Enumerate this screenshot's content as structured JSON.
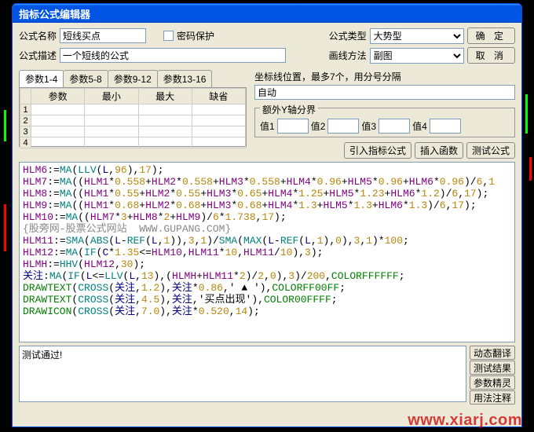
{
  "window": {
    "title": "指标公式编辑器"
  },
  "labels": {
    "formula_name": "公式名称",
    "password": "密码保护",
    "formula_type": "公式类型",
    "formula_desc": "公式描述",
    "draw_method": "画线方法",
    "coord_hint": "坐标线位置，最多7个，用分号分隔",
    "extra_y": "额外Y轴分界",
    "v1": "值1",
    "v2": "值2",
    "v3": "值3",
    "v4": "值4"
  },
  "values": {
    "formula_name": "短线买点",
    "formula_desc": "一个短线的公式",
    "formula_type_selected": "大势型",
    "draw_method_selected": "副图",
    "coord_value": "自动",
    "test_result": "测试通过!"
  },
  "buttons": {
    "ok": "确 定",
    "cancel": "取 消",
    "import": "引入指标公式",
    "insert_fn": "插入函数",
    "test": "测试公式",
    "dyn_trans": "动态翻译",
    "test_result": "测试结果",
    "param_wizard": "参数精灵",
    "usage": "用法注释"
  },
  "param_tabs": [
    "参数1-4",
    "参数5-8",
    "参数9-12",
    "参数13-16"
  ],
  "param_headers": [
    "参数",
    "最小",
    "最大",
    "缺省"
  ],
  "code_lines": [
    [
      [
        "c-id",
        "HLM6"
      ],
      [
        "",
        ":="
      ],
      [
        "c-fn",
        "MA"
      ],
      [
        "",
        "("
      ],
      [
        "c-fn",
        "LLV"
      ],
      [
        "",
        "("
      ],
      [
        "c-nav",
        "L"
      ],
      [
        "",
        ","
      ],
      [
        "c-num",
        "96"
      ],
      [
        "",
        "),"
      ],
      [
        "c-num",
        "17"
      ],
      [
        "",
        ");"
      ]
    ],
    [
      [
        "c-id",
        "HLM7"
      ],
      [
        "",
        ":="
      ],
      [
        "c-fn",
        "MA"
      ],
      [
        "",
        "(("
      ],
      [
        "c-id",
        "HLM1"
      ],
      [
        "",
        "*"
      ],
      [
        "c-num",
        "0.558"
      ],
      [
        "",
        "+"
      ],
      [
        "c-id",
        "HLM2"
      ],
      [
        "",
        "*"
      ],
      [
        "c-num",
        "0.558"
      ],
      [
        "",
        "+"
      ],
      [
        "c-id",
        "HLM3"
      ],
      [
        "",
        "*"
      ],
      [
        "c-num",
        "0.558"
      ],
      [
        "",
        "+"
      ],
      [
        "c-id",
        "HLM4"
      ],
      [
        "",
        "*"
      ],
      [
        "c-num",
        "0.96"
      ],
      [
        "",
        "+"
      ],
      [
        "c-id",
        "HLM5"
      ],
      [
        "",
        "*"
      ],
      [
        "c-num",
        "0.96"
      ],
      [
        "",
        "+"
      ],
      [
        "c-id",
        "HLM6"
      ],
      [
        "",
        "*"
      ],
      [
        "c-num",
        "0.96"
      ],
      [
        "",
        ")/"
      ],
      [
        "c-num",
        "6"
      ],
      [
        "",
        ","
      ],
      [
        "c-num",
        "1"
      ]
    ],
    [
      [
        "c-id",
        "HLM8"
      ],
      [
        "",
        ":="
      ],
      [
        "c-fn",
        "MA"
      ],
      [
        "",
        "(("
      ],
      [
        "c-id",
        "HLM1"
      ],
      [
        "",
        "*"
      ],
      [
        "c-num",
        "0.55"
      ],
      [
        "",
        "+"
      ],
      [
        "c-id",
        "HLM2"
      ],
      [
        "",
        "*"
      ],
      [
        "c-num",
        "0.55"
      ],
      [
        "",
        "+"
      ],
      [
        "c-id",
        "HLM3"
      ],
      [
        "",
        "*"
      ],
      [
        "c-num",
        "0.65"
      ],
      [
        "",
        "+"
      ],
      [
        "c-id",
        "HLM4"
      ],
      [
        "",
        "*"
      ],
      [
        "c-num",
        "1.25"
      ],
      [
        "",
        "+"
      ],
      [
        "c-id",
        "HLM5"
      ],
      [
        "",
        "*"
      ],
      [
        "c-num",
        "1.23"
      ],
      [
        "",
        "+"
      ],
      [
        "c-id",
        "HLM6"
      ],
      [
        "",
        "*"
      ],
      [
        "c-num",
        "1.2"
      ],
      [
        "",
        ")/"
      ],
      [
        "c-num",
        "6"
      ],
      [
        "",
        ","
      ],
      [
        "c-num",
        "17"
      ],
      [
        "",
        ");"
      ]
    ],
    [
      [
        "c-id",
        "HLM9"
      ],
      [
        "",
        ":="
      ],
      [
        "c-fn",
        "MA"
      ],
      [
        "",
        "(("
      ],
      [
        "c-id",
        "HLM1"
      ],
      [
        "",
        "*"
      ],
      [
        "c-num",
        "0.68"
      ],
      [
        "",
        "+"
      ],
      [
        "c-id",
        "HLM2"
      ],
      [
        "",
        "*"
      ],
      [
        "c-num",
        "0.68"
      ],
      [
        "",
        "+"
      ],
      [
        "c-id",
        "HLM3"
      ],
      [
        "",
        "*"
      ],
      [
        "c-num",
        "0.68"
      ],
      [
        "",
        "+"
      ],
      [
        "c-id",
        "HLM4"
      ],
      [
        "",
        "*"
      ],
      [
        "c-num",
        "1.3"
      ],
      [
        "",
        "+"
      ],
      [
        "c-id",
        "HLM5"
      ],
      [
        "",
        "*"
      ],
      [
        "c-num",
        "1.3"
      ],
      [
        "",
        "+"
      ],
      [
        "c-id",
        "HLM6"
      ],
      [
        "",
        "*"
      ],
      [
        "c-num",
        "1.3"
      ],
      [
        "",
        ")/"
      ],
      [
        "c-num",
        "6"
      ],
      [
        "",
        ","
      ],
      [
        "c-num",
        "17"
      ],
      [
        "",
        ");"
      ]
    ],
    [
      [
        "c-id",
        "HLM10"
      ],
      [
        "",
        ":="
      ],
      [
        "c-fn",
        "MA"
      ],
      [
        "",
        "(("
      ],
      [
        "c-id",
        "HLM7"
      ],
      [
        "",
        "*"
      ],
      [
        "c-num",
        "3"
      ],
      [
        "",
        "+"
      ],
      [
        "c-id",
        "HLM8"
      ],
      [
        "",
        "*"
      ],
      [
        "c-num",
        "2"
      ],
      [
        "",
        "+"
      ],
      [
        "c-id",
        "HLM9"
      ],
      [
        "",
        ")/"
      ],
      [
        "c-num",
        "6"
      ],
      [
        "",
        "*"
      ],
      [
        "c-num",
        "1.738"
      ],
      [
        "",
        ","
      ],
      [
        "c-num",
        "17"
      ],
      [
        "",
        ");"
      ]
    ],
    [
      [
        "c-gry",
        "{股旁网-股票公式网站  WWW.GUPANG.COM}"
      ]
    ],
    [
      [
        "c-id",
        "HLM11"
      ],
      [
        "",
        ":="
      ],
      [
        "c-fn",
        "SMA"
      ],
      [
        "",
        "("
      ],
      [
        "c-fn",
        "ABS"
      ],
      [
        "",
        "("
      ],
      [
        "c-nav",
        "L"
      ],
      [
        "",
        "-"
      ],
      [
        "c-fn",
        "REF"
      ],
      [
        "",
        "("
      ],
      [
        "c-nav",
        "L"
      ],
      [
        "",
        ","
      ],
      [
        "c-num",
        "1"
      ],
      [
        "",
        ")),"
      ],
      [
        "c-num",
        "3"
      ],
      [
        "",
        ","
      ],
      [
        "c-num",
        "1"
      ],
      [
        "",
        ")/"
      ],
      [
        "c-fn",
        "SMA"
      ],
      [
        "",
        "("
      ],
      [
        "c-fn",
        "MAX"
      ],
      [
        "",
        "("
      ],
      [
        "c-nav",
        "L"
      ],
      [
        "",
        "-"
      ],
      [
        "c-fn",
        "REF"
      ],
      [
        "",
        "("
      ],
      [
        "c-nav",
        "L"
      ],
      [
        "",
        ","
      ],
      [
        "c-num",
        "1"
      ],
      [
        "",
        "),"
      ],
      [
        "c-num",
        "0"
      ],
      [
        "",
        "),"
      ],
      [
        "c-num",
        "3"
      ],
      [
        "",
        ","
      ],
      [
        "c-num",
        "1"
      ],
      [
        "",
        ")*"
      ],
      [
        "c-num",
        "100"
      ],
      [
        "",
        ";"
      ]
    ],
    [
      [
        "c-id",
        "HLM12"
      ],
      [
        "",
        ":="
      ],
      [
        "c-fn",
        "MA"
      ],
      [
        "",
        "("
      ],
      [
        "c-fn",
        "IF"
      ],
      [
        "",
        "("
      ],
      [
        "c-nav",
        "C"
      ],
      [
        "",
        "*"
      ],
      [
        "c-num",
        "1.35"
      ],
      [
        "",
        "<="
      ],
      [
        "c-id",
        "HLM10"
      ],
      [
        "",
        ","
      ],
      [
        "c-id",
        "HLM11"
      ],
      [
        "",
        "*"
      ],
      [
        "c-num",
        "10"
      ],
      [
        "",
        ","
      ],
      [
        "c-id",
        "HLM11"
      ],
      [
        "",
        "/"
      ],
      [
        "c-num",
        "10"
      ],
      [
        "",
        "),"
      ],
      [
        "c-num",
        "3"
      ],
      [
        "",
        ");"
      ]
    ],
    [
      [
        "c-id",
        "HLMH"
      ],
      [
        "",
        ":="
      ],
      [
        "c-fn",
        "HHV"
      ],
      [
        "",
        "("
      ],
      [
        "c-id",
        "HLM12"
      ],
      [
        "",
        ","
      ],
      [
        "c-num",
        "30"
      ],
      [
        "",
        ");"
      ]
    ],
    [
      [
        "c-nav",
        "关注"
      ],
      [
        "",
        ":"
      ],
      [
        "c-fn",
        "MA"
      ],
      [
        "",
        "("
      ],
      [
        "c-fn",
        "IF"
      ],
      [
        "",
        "("
      ],
      [
        "c-nav",
        "L"
      ],
      [
        "",
        "<="
      ],
      [
        "c-fn",
        "LLV"
      ],
      [
        "",
        "("
      ],
      [
        "c-nav",
        "L"
      ],
      [
        "",
        ","
      ],
      [
        "c-num",
        "13"
      ],
      [
        "",
        "),("
      ],
      [
        "c-id",
        "HLMH"
      ],
      [
        "",
        "+"
      ],
      [
        "c-id",
        "HLM11"
      ],
      [
        "",
        "*"
      ],
      [
        "c-num",
        "2"
      ],
      [
        "",
        ")/"
      ],
      [
        "c-num",
        "2"
      ],
      [
        "",
        ","
      ],
      [
        "c-num",
        "0"
      ],
      [
        "",
        "),"
      ],
      [
        "c-num",
        "3"
      ],
      [
        "",
        ")/"
      ],
      [
        "c-num",
        "200"
      ],
      [
        "",
        ","
      ],
      [
        "c-clr",
        "COLORFFFFFF"
      ],
      [
        "",
        ";"
      ]
    ],
    [
      [
        "c-clr",
        "DRAWTEXT"
      ],
      [
        "",
        "("
      ],
      [
        "c-fn",
        "CROSS"
      ],
      [
        "",
        "("
      ],
      [
        "c-nav",
        "关注"
      ],
      [
        "",
        ","
      ],
      [
        "c-num",
        "1.2"
      ],
      [
        "",
        "),"
      ],
      [
        "c-nav",
        "关注"
      ],
      [
        "",
        "*"
      ],
      [
        "c-num",
        "0.86"
      ],
      [
        "",
        ",' ▲ '),"
      ],
      [
        "c-clr",
        "COLORFF00FF"
      ],
      [
        "",
        ";"
      ]
    ],
    [
      [
        "c-clr",
        "DRAWTEXT"
      ],
      [
        "",
        "("
      ],
      [
        "c-fn",
        "CROSS"
      ],
      [
        "",
        "("
      ],
      [
        "c-nav",
        "关注"
      ],
      [
        "",
        ","
      ],
      [
        "c-num",
        "4.5"
      ],
      [
        "",
        "),"
      ],
      [
        "c-nav",
        "关注"
      ],
      [
        "",
        ",'买点出现'),"
      ],
      [
        "c-clr",
        "COLOR00FFFF"
      ],
      [
        "",
        ";"
      ]
    ],
    [
      [
        "c-clr",
        "DRAWICON"
      ],
      [
        "",
        "("
      ],
      [
        "c-fn",
        "CROSS"
      ],
      [
        "",
        "("
      ],
      [
        "c-nav",
        "关注"
      ],
      [
        "",
        ","
      ],
      [
        "c-num",
        "7.0"
      ],
      [
        "",
        "),"
      ],
      [
        "c-nav",
        "关注"
      ],
      [
        "",
        "*"
      ],
      [
        "c-num",
        "0.520"
      ],
      [
        "",
        ","
      ],
      [
        "c-num",
        "14"
      ],
      [
        "",
        ");"
      ]
    ]
  ],
  "watermark": "www.xiarj.com"
}
